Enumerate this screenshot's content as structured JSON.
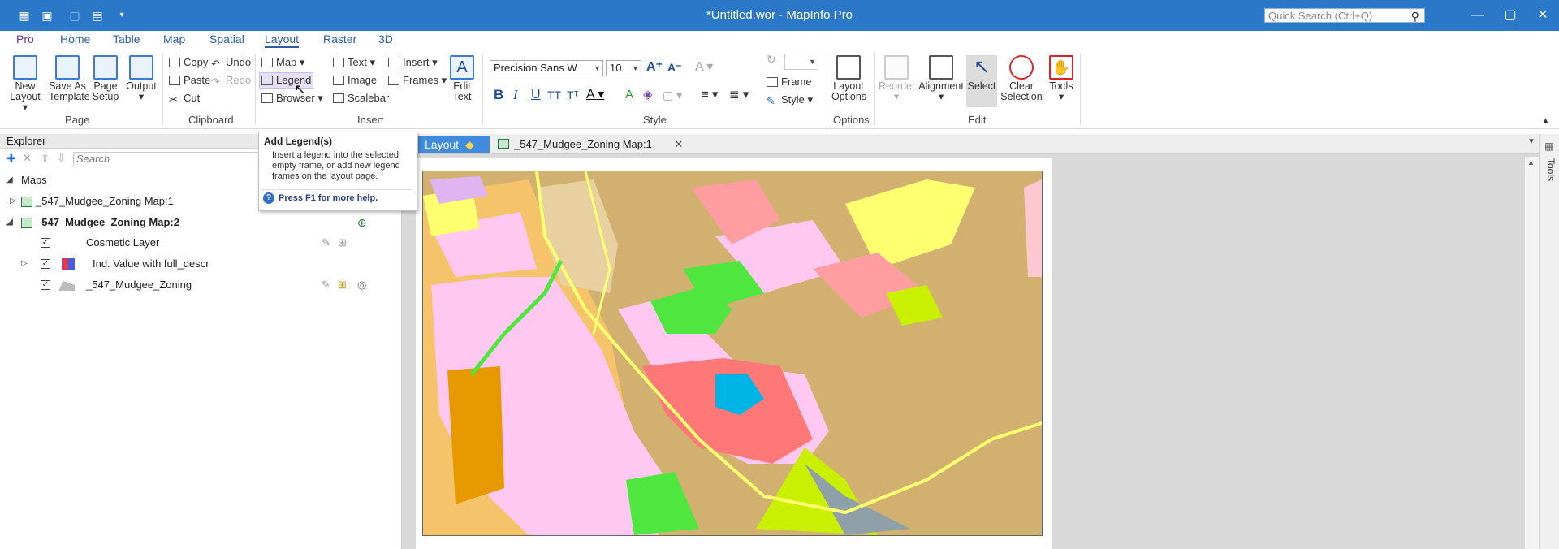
{
  "window": {
    "title": "*Untitled.wor - MapInfo Pro",
    "search_placeholder": "Quick Search (Ctrl+Q)"
  },
  "ribbon_tabs": [
    "Pro",
    "Home",
    "Table",
    "Map",
    "Spatial",
    "Layout",
    "Raster",
    "3D"
  ],
  "page_group": {
    "label": "Page",
    "new_layout": "New Layout",
    "save_template": "Save As Template",
    "page_setup": "Page Setup",
    "output": "Output"
  },
  "clipboard_group": {
    "label": "Clipboard",
    "copy": "Copy",
    "paste": "Paste",
    "cut": "Cut",
    "undo": "Undo",
    "redo": "Redo"
  },
  "insert_group": {
    "label": "Insert",
    "map": "Map",
    "legend": "Legend",
    "browser": "Browser",
    "text": "Text",
    "image": "Image",
    "scalebar": "Scalebar",
    "insert": "Insert",
    "frames": "Frames",
    "edit_text": "Edit Text"
  },
  "style_group": {
    "label": "Style",
    "font_name": "Precision Sans W",
    "font_size": "10",
    "frame": "Frame",
    "style": "Style"
  },
  "options_group": {
    "label": "Options",
    "layout_options": "Layout Options"
  },
  "edit_group": {
    "label": "Edit",
    "reorder": "Reorder",
    "alignment": "Alignment",
    "select": "Select",
    "clear_selection": "Clear Selection",
    "tools": "Tools"
  },
  "tooltip": {
    "title": "Add Legend(s)",
    "description": "Insert a legend into the selected empty frame, or add new legend frames on the layout page.",
    "help": "Press F1 for more help."
  },
  "explorer": {
    "title": "Explorer",
    "search_placeholder": "Search",
    "root": "Maps",
    "items": [
      {
        "label": "_547_Mudgee_Zoning Map:1"
      },
      {
        "label": "_547_Mudgee_Zoning Map:2"
      }
    ],
    "layers": [
      {
        "label": "Cosmetic Layer"
      },
      {
        "label": "Ind. Value with full_descr"
      },
      {
        "label": "_547_Mudgee_Zoning"
      }
    ]
  },
  "doc_tabs": [
    "Layout",
    "_547_Mudgee_Zoning Map:1"
  ],
  "side_panel": "Tools",
  "colors": {
    "title_bar": "#2b78c9",
    "active_tab": "#3f8be0",
    "rural": "#d2b070",
    "residential": "#ffc8f0",
    "business": "#ff7878",
    "recreation": "#50e640",
    "water": "#00b4e6"
  }
}
